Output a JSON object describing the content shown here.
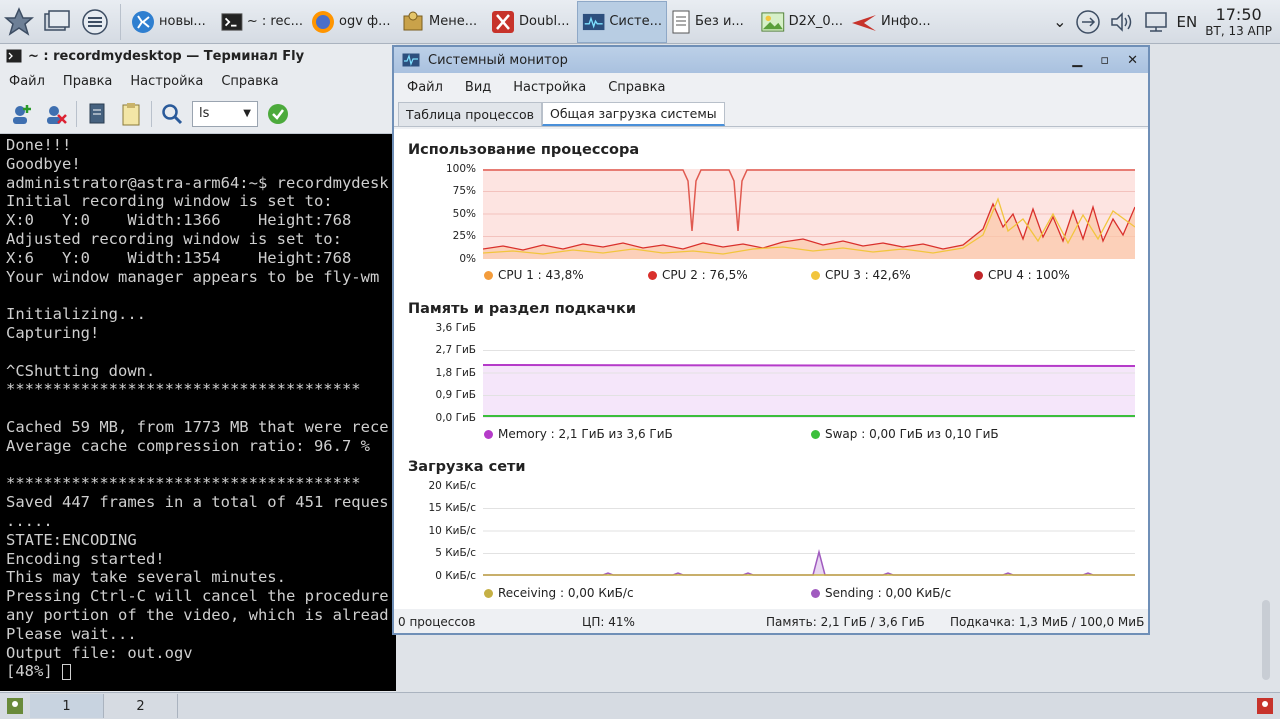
{
  "taskbar": {
    "tasks": [
      {
        "label": "новы...",
        "icon": "kde-icon"
      },
      {
        "label": "~ : rec...",
        "icon": "terminal-icon"
      },
      {
        "label": "ogv ф...",
        "icon": "firefox-icon"
      },
      {
        "label": "Мене...",
        "icon": "package-manager-icon"
      },
      {
        "label": "Doubl...",
        "icon": "doublecmd-icon"
      },
      {
        "label": "Систе...",
        "icon": "system-monitor-icon"
      },
      {
        "label": "Без и...",
        "icon": "document-icon"
      },
      {
        "label": "D2X_0...",
        "icon": "image-viewer-icon"
      },
      {
        "label": "Инфо...",
        "icon": "astra-icon"
      }
    ],
    "layout": "EN",
    "clock_time": "17:50",
    "clock_date": "ВТ, 13 АПР"
  },
  "terminal": {
    "title": "~ : recordmydesktop — Терминал Fly",
    "menu": [
      "Файл",
      "Правка",
      "Настройка",
      "Справка"
    ],
    "combo_value": "ls",
    "lines": [
      "Done!!!",
      "Goodbye!",
      "administrator@astra-arm64:~$ recordmydesk",
      "Initial recording window is set to:",
      "X:0   Y:0    Width:1366    Height:768",
      "Adjusted recording window is set to:",
      "X:6   Y:0    Width:1354    Height:768",
      "Your window manager appears to be fly-wm",
      "",
      "Initializing...",
      "Capturing!",
      "",
      "^CShutting down.",
      "**************************************",
      "",
      "Cached 59 MB, from 1773 MB that were rece",
      "Average cache compression ratio: 96.7 %",
      "",
      "**************************************",
      "Saved 447 frames in a total of 451 reques",
      ".....",
      "STATE:ENCODING",
      "Encoding started!",
      "This may take several minutes.",
      "Pressing Ctrl-C will cancel the procedure",
      "any portion of the video, which is alread",
      "Please wait...",
      "Output file: out.ogv",
      "[48%] "
    ]
  },
  "desktops": [
    "1",
    "2"
  ],
  "sysmon": {
    "title": "Системный монитор",
    "menu": [
      "Файл",
      "Вид",
      "Настройка",
      "Справка"
    ],
    "tabs": [
      "Таблица процессов",
      "Общая загрузка системы"
    ],
    "cpu": {
      "title": "Использование процессора",
      "y_ticks": [
        "100%",
        "75%",
        "50%",
        "25%",
        "0%"
      ],
      "legend": [
        {
          "label": "CPU 1 : 43,8%",
          "color": "#f39c3c"
        },
        {
          "label": "CPU 2 : 76,5%",
          "color": "#d9302c"
        },
        {
          "label": "CPU 3 : 42,6%",
          "color": "#f2c53d"
        },
        {
          "label": "CPU 4 : 100%",
          "color": "#c0262a"
        }
      ]
    },
    "memory": {
      "title": "Память и раздел подкачки",
      "y_ticks": [
        "3,6 ГиБ",
        "2,7 ГиБ",
        "1,8 ГиБ",
        "0,9 ГиБ",
        "0,0 ГиБ"
      ],
      "legend": [
        {
          "label": "Memory : 2,1 ГиБ из 3,6 ГиБ",
          "color": "#b53bc9"
        },
        {
          "label": "Swap : 0,00 ГиБ из 0,10 ГиБ",
          "color": "#3cbf3c"
        }
      ]
    },
    "network": {
      "title": "Загрузка сети",
      "y_ticks": [
        "20 КиБ/с",
        "15 КиБ/с",
        "10 КиБ/с",
        "5 КиБ/с",
        "0 КиБ/с"
      ],
      "legend": [
        {
          "label": "Receiving : 0,00 КиБ/с",
          "color": "#c5b045"
        },
        {
          "label": "Sending : 0,00 КиБ/с",
          "color": "#a05bbf"
        }
      ]
    },
    "status": {
      "processes": "0 процессов",
      "cpu": "ЦП: 41%",
      "memory": "Память: 2,1 ГиБ / 3,6 ГиБ",
      "swap": "Подкачка: 1,3 МиБ / 100,0 МиБ"
    }
  }
}
